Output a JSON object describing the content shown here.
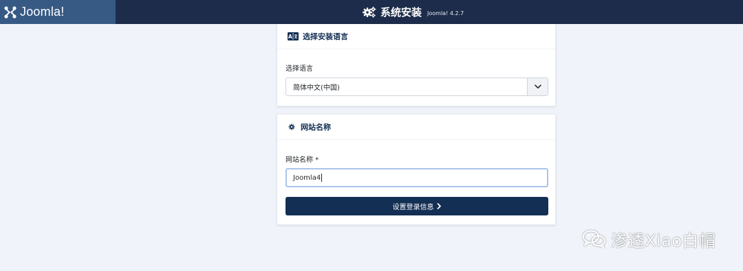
{
  "topbar": {
    "brand_name": "Joomla!",
    "title": "系统安装",
    "version": "Joomla! 4.2.7",
    "colors": {
      "bar": "#1d2c4a",
      "brand_bg": "#375a85"
    }
  },
  "language_card": {
    "title": "选择安装语言",
    "icon": "language-icon",
    "field_label": "选择语言",
    "selected_value": "简体中文(中国)"
  },
  "site_card": {
    "title": "网站名称",
    "icon": "gear-icon",
    "field_label": "网站名称",
    "required_mark": "*",
    "input_value": "Joomla4",
    "button_label": "设置登录信息"
  },
  "watermark": {
    "text": "渗透Xiao白帽",
    "icon": "wechat-icon"
  },
  "colors": {
    "page_bg": "#f0f4fa",
    "primary": "#132f53"
  }
}
